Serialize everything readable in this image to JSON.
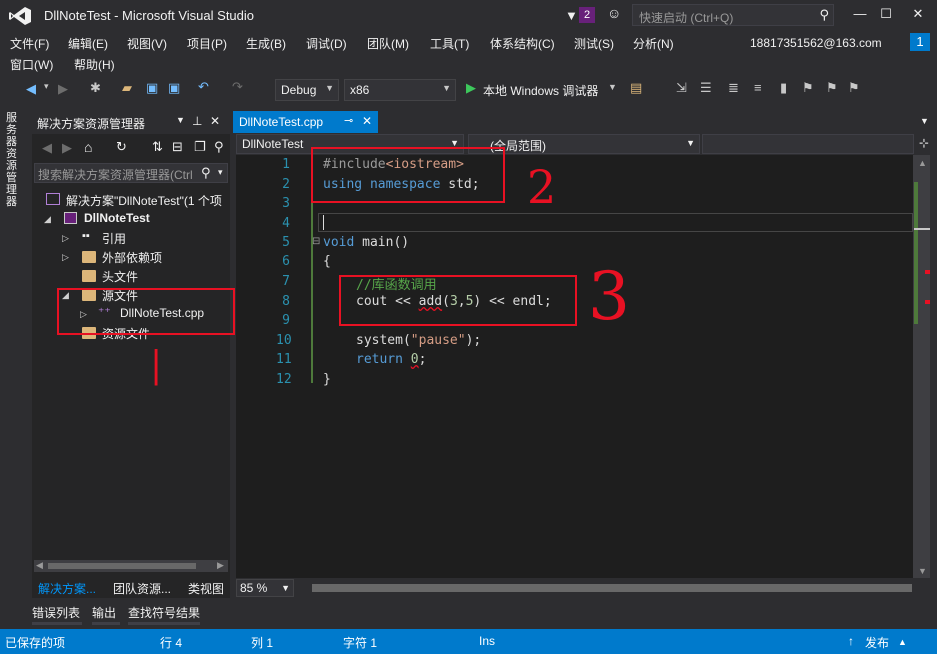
{
  "app": {
    "title": "DllNoteTest - Microsoft Visual Studio",
    "notification_count": "2",
    "quick_launch_placeholder": "快速启动 (Ctrl+Q)",
    "window_min": "—",
    "window_max": "☐",
    "window_close": "✕"
  },
  "menu": {
    "items": [
      "文件(F)",
      "编辑(E)",
      "视图(V)",
      "项目(P)",
      "生成(B)",
      "调试(D)",
      "团队(M)",
      "工具(T)",
      "体系结构(C)",
      "测试(S)",
      "分析(N)"
    ],
    "row2": [
      "窗口(W)",
      "帮助(H)"
    ],
    "account": "18817351562@163.com",
    "account_badge": "1"
  },
  "toolbar": {
    "config": "Debug",
    "platform": "x86",
    "run_label": "本地 Windows 调试器"
  },
  "side_strip_label": "服务器资源管理器",
  "solution_explorer": {
    "title": "解决方案资源管理器",
    "search_placeholder": "搜索解决方案资源管理器(Ctrl",
    "tree": {
      "solution": "解决方案\"DllNoteTest\"(1 个项",
      "project": "DllNoteTest",
      "references": "引用",
      "external_deps": "外部依赖项",
      "headers": "头文件",
      "sources": "源文件",
      "source_file": "DllNoteTest.cpp",
      "resources": "资源文件"
    },
    "bottom_tabs": [
      "解决方案...",
      "团队资源...",
      "类视图"
    ]
  },
  "editor": {
    "tab_label": "DllNoteTest.cpp",
    "tab_pin": "⊸",
    "tab_close": "✕",
    "nav_left": "DllNoteTest",
    "nav_scope": "(全局范围)",
    "zoom": "85 %",
    "line_numbers": [
      "1",
      "2",
      "3",
      "4",
      "5",
      "6",
      "7",
      "8",
      "9",
      "10",
      "11",
      "12"
    ],
    "code": {
      "l1_pp": "#include",
      "l1_str": "<iostream>",
      "l2_kw1": "using",
      "l2_kw2": "namespace",
      "l2_rest": " std;",
      "l5_kw": "void",
      "l5_rest": " main()",
      "l6": "{",
      "l7": "//库函数调用",
      "l8_a": "cout << ",
      "l8_b": "add",
      "l8_c": "(",
      "l8_d": "3",
      "l8_e": ",",
      "l8_f": "5",
      "l8_g": ") << endl;",
      "l10_a": "system(",
      "l10_b": "\"pause\"",
      "l10_c": ");",
      "l11_kw": "return",
      "l11_sp": " ",
      "l11_num": "0",
      "l11_end": ";",
      "l12": "}"
    }
  },
  "annotations": {
    "a1": "|",
    "a2": "2",
    "a3": "3"
  },
  "output_tabs": [
    "错误列表",
    "输出",
    "查找符号结果"
  ],
  "status": {
    "left": "已保存的项",
    "line": "行 4",
    "col": "列 1",
    "char": "字符 1",
    "mode": "Ins",
    "publish": "发布"
  }
}
